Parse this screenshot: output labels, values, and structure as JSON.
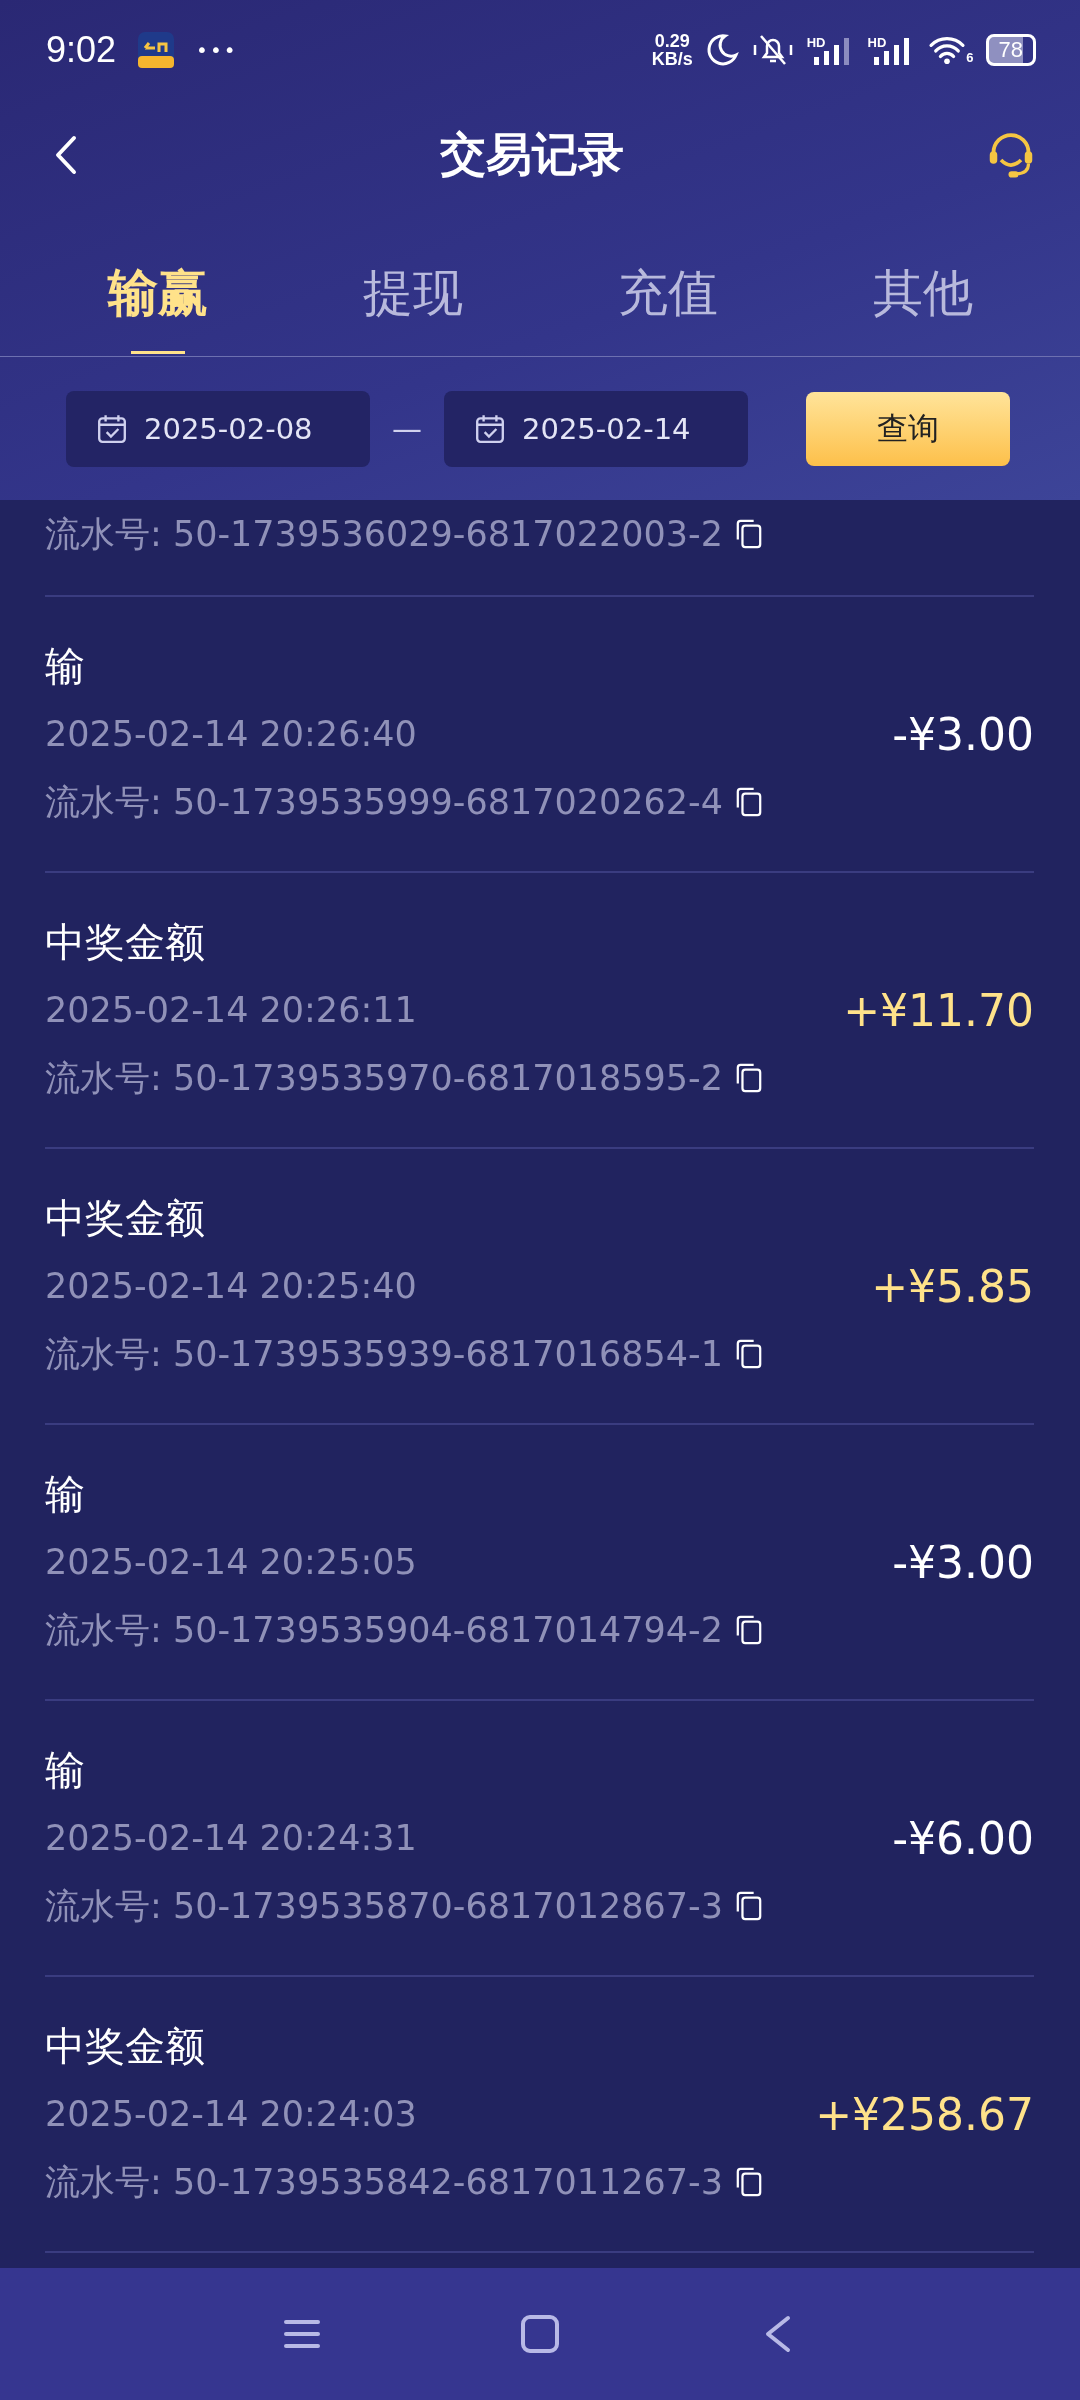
{
  "status_bar": {
    "time": "9:02",
    "more": "•••",
    "net_speed_value": "0.29",
    "net_speed_unit": "KB/s",
    "signal_1_label": "HD",
    "signal_2_label": "HD",
    "wifi_label": "6",
    "battery": "78"
  },
  "header": {
    "title": "交易记录"
  },
  "tabs": [
    {
      "label": "输赢",
      "selected": true
    },
    {
      "label": "提现",
      "selected": false
    },
    {
      "label": "充值",
      "selected": false
    },
    {
      "label": "其他",
      "selected": false
    }
  ],
  "filter": {
    "start_date": "2025-02-08",
    "separator": "—",
    "end_date": "2025-02-14",
    "query_button": "查询"
  },
  "records": [
    {
      "serial": "流水号: 50-1739536029-6817022003-2"
    },
    {
      "title": "输",
      "time": "2025-02-14 20:26:40",
      "amount": "-¥3.00",
      "kind": "debit",
      "serial": "流水号: 50-1739535999-6817020262-4"
    },
    {
      "title": "中奖金额",
      "time": "2025-02-14 20:26:11",
      "amount": "+¥11.70",
      "kind": "credit",
      "serial": "流水号: 50-1739535970-6817018595-2"
    },
    {
      "title": "中奖金额",
      "time": "2025-02-14 20:25:40",
      "amount": "+¥5.85",
      "kind": "credit",
      "serial": "流水号: 50-1739535939-6817016854-1"
    },
    {
      "title": "输",
      "time": "2025-02-14 20:25:05",
      "amount": "-¥3.00",
      "kind": "debit",
      "serial": "流水号: 50-1739535904-6817014794-2"
    },
    {
      "title": "输",
      "time": "2025-02-14 20:24:31",
      "amount": "-¥6.00",
      "kind": "debit",
      "serial": "流水号: 50-1739535870-6817012867-3"
    },
    {
      "title": "中奖金额",
      "time": "2025-02-14 20:24:03",
      "amount": "+¥258.67",
      "kind": "credit",
      "serial": "流水号: 50-1739535842-6817011267-3"
    }
  ]
}
